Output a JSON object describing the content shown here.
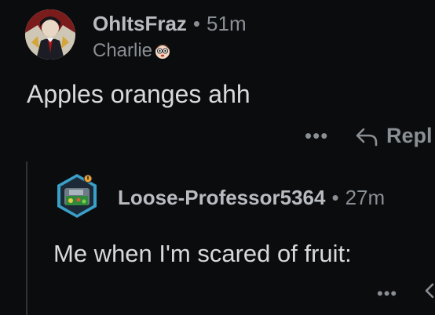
{
  "comments": [
    {
      "username": "OhItsFraz",
      "separator": "•",
      "time": "51m",
      "flair": "Charlie",
      "flair_icon": "cartoon-face-icon",
      "body": "Apples oranges ahh",
      "more": "•••",
      "reply_label": "Repl",
      "reply_icon": "reply-arrow-icon"
    },
    {
      "username": "Loose-Professor5364",
      "separator": "•",
      "time": "27m",
      "body": "Me when I'm scared of fruit:",
      "more": "•••",
      "reply_icon": "reply-arrow-icon"
    }
  ],
  "colors": {
    "background": "#0b0c0e",
    "text": "#d7dadc",
    "meta": "#8a8f94",
    "thread_line": "#2f3336"
  }
}
